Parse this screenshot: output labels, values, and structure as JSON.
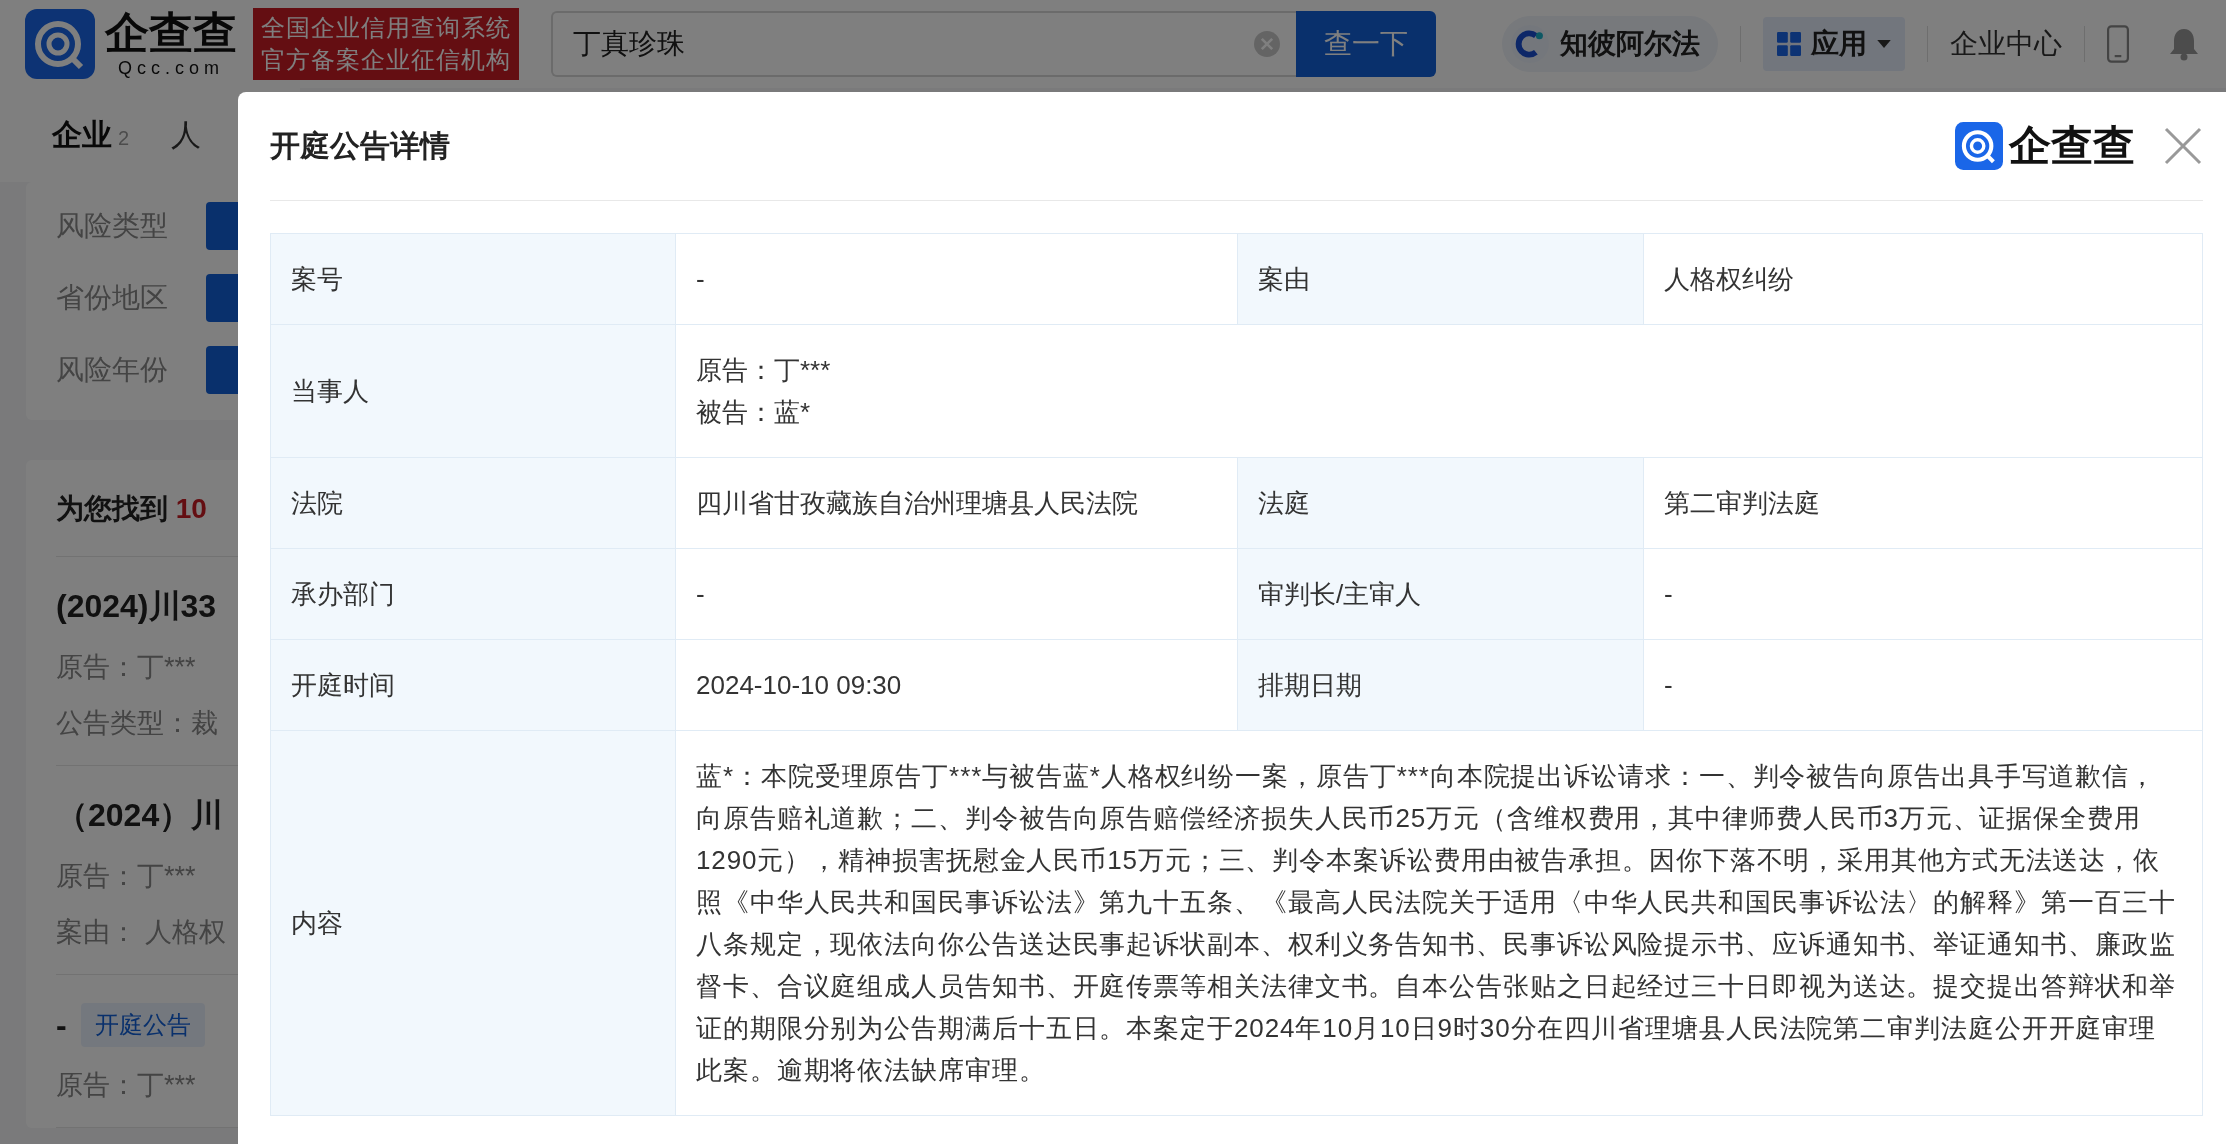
{
  "header": {
    "logo_text": "企查查",
    "logo_sub": "Qcc.com",
    "slogan": [
      "全国企业信用查询系统",
      "官方备案企业征信机构"
    ],
    "search": {
      "value": "丁真珍珠"
    },
    "search_button": "查一下",
    "alpha": "知彼阿尔法",
    "apps": "应用",
    "enterprise": "企业中心"
  },
  "sidebar": {
    "tabs": [
      {
        "label": "企业",
        "count": "2",
        "selected": true
      },
      {
        "label": "人",
        "selected": false
      }
    ],
    "filters": [
      "风险类型",
      "省份地区",
      "风险年份"
    ],
    "results_header": {
      "prefix": "为您找到",
      "count": "10"
    },
    "results": [
      {
        "kind": "case",
        "title": "(2024)川33",
        "lines": [
          "原告：丁***",
          "公告类型：裁"
        ]
      },
      {
        "kind": "case",
        "title": "（2024）川",
        "lines": [
          "原告：丁***",
          "案由： 人格权"
        ]
      },
      {
        "kind": "tagged",
        "title": "-",
        "tag": "开庭公告",
        "lines": [
          "原告：丁***"
        ]
      }
    ]
  },
  "modal": {
    "title": "开庭公告详情",
    "brand": "企查查",
    "rows": [
      {
        "fields": [
          {
            "label": "案号",
            "lines": [
              "-"
            ]
          },
          {
            "label": "案由",
            "lines": [
              "人格权纠纷"
            ]
          }
        ]
      },
      {
        "fields": [
          {
            "label": "当事人",
            "lines": [
              "原告：丁***",
              "被告：蓝*"
            ]
          }
        ]
      },
      {
        "fields": [
          {
            "label": "法院",
            "lines": [
              "四川省甘孜藏族自治州理塘县人民法院"
            ]
          },
          {
            "label": "法庭",
            "lines": [
              "第二审判法庭"
            ]
          }
        ]
      },
      {
        "fields": [
          {
            "label": "承办部门",
            "lines": [
              "-"
            ]
          },
          {
            "label": "审判长/主审人",
            "lines": [
              "-"
            ]
          }
        ]
      },
      {
        "fields": [
          {
            "label": "开庭时间",
            "lines": [
              "2024-10-10 09:30"
            ]
          },
          {
            "label": "排期日期",
            "lines": [
              "-"
            ]
          }
        ]
      },
      {
        "fields": [
          {
            "label": "内容",
            "lines": [
              "蓝*：本院受理原告丁***与被告蓝*人格权纠纷一案，原告丁***向本院提出诉讼请求：一、判令被告向原告出具手写道歉信，向原告赔礼道歉；二、判令被告向原告赔偿经济损失人民币25万元（含维权费用，其中律师费人民币3万元、证据保全费用1290元），精神损害抚慰金人民币15万元；三、判令本案诉讼费用由被告承担。因你下落不明，采用其他方式无法送达，依照《中华人民共和国民事诉讼法》第九十五条、《最高人民法院关于适用〈中华人民共和国民事诉讼法〉的解释》第一百三十八条规定，现依法向你公告送达民事起诉状副本、权利义务告知书、民事诉讼风险提示书、应诉通知书、举证通知书、廉政监督卡、合议庭组成人员告知书、开庭传票等相关法律文书。自本公告张贴之日起经过三十日即视为送达。提交提出答辩状和举证的期限分别为公告期满后十五日。本案定于2024年10月10日9时30分在四川省理塘县人民法院第二审判法庭公开开庭审理此案。逾期将依法缺席审理。"
            ]
          }
        ]
      }
    ]
  }
}
